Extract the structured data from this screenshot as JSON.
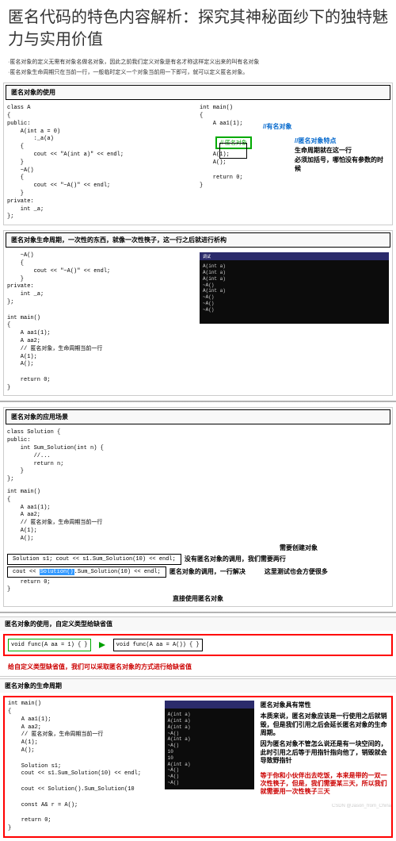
{
  "title": "匿名代码的特色内容解析：探究其神秘面纱下的独特魅力与实用价值",
  "intro1": "·匿名对象的定义无需有对象名做名对象，因此之前我们定义对象是有名才称这样定义出来的叫有名对象",
  "intro2": "·匿名对象生命周期只在当前一行，一般临时定义一个对象当前用一下即可，就可以定义匿名对象。",
  "sec1": {
    "header": "匿名对象的使用",
    "code_left": "class A\n{\npublic:\n    A(int a = 0)\n        :_a(a)\n    {\n        cout << \"A(int a)\" << endl;\n    }\n    ~A()\n    {\n        cout << \"~A()\" << endl;\n    }\nprivate:\n    int _a;\n};",
    "code_right": "int main()\n{\n    A aa1(1);\n\n\n\n    A(1);\n    A();\n\n    return 0;\n}",
    "note1": "//有名对象",
    "note_box": "// 匿名对象",
    "note2": "//匿名对象特点",
    "note3": "生命周期就在这一行",
    "note4": "必须加括号，哪怕没有参数的时候"
  },
  "sec2": {
    "header": "匿名对象生命周期，一次性的东西，就像一次性筷子，这一行之后就进行析构",
    "code": "    ~A()\n    {\n        cout << \"~A()\" << endl;\n    }\nprivate:\n    int _a;\n};\n\nint main()\n{\n    A aa1(1);\n    A aa2;\n    // 匿名对象，生命周期当前一行\n    A(1);\n    A();\n\n    return 0;\n}",
    "terminal": "A(int a)\nA(int a)\nA(int a)\n~A()\nA(int a)\n~A()\n~A()\n~A()"
  },
  "sec3": {
    "header": "匿名对象的应用场景",
    "code_top": "class Solution {\npublic:\n    int Sum_Solution(int n) {\n        //...\n        return n;\n    }\n};",
    "code_main": "int main()\n{\n    A aa1(1);\n    A aa2;\n    // 匿名对象，生命周期当前一行\n    A(1);\n    A();",
    "line_need": "需要创建对象",
    "boxed1": "Solution s1;\ncout << s1.Sum_Solution(10) << endl;",
    "annot1": "没有匿名对象的调用，我们需要两行",
    "boxed2": "cout << Solution().Sum_Solution(10) << endl;",
    "highlight": "Solution()",
    "annot2": "匿名对象的调用，一行解决",
    "annot3": "这里测试也会方便很多",
    "annot4": "直接使用匿名对象",
    "code_end": "    return 0;\n}"
  },
  "sec4": {
    "header": "匿名对象的使用，自定义类型给缺省值",
    "code_left": "void func(A aa = 1)\n{\n}",
    "code_right": "void func(A aa = A())\n{\n}",
    "red_text": "给自定义类型缺省值，我们可以采取匿名对象的方式进行给缺省值"
  },
  "sec5": {
    "header": "匿名对象的生命周期",
    "code": "int main()\n{\n    A aa1(1);\n    A aa2;\n    // 匿名对象，生命周期当前一行\n    A(1);\n    A();\n\n    Solution s1;\n    cout << s1.Sum_Solution(10) << endl;\n\n    cout << Solution().Sum_Solution(10\n\n    const A& r = A();\n\n    return 0;\n}",
    "terminal": "A(int a)\nA(int a)\nA(int a)\n~A()\nA(int a)\n~A()\n10\n10\nA(int a)\n~A()\n~A()\n~A()",
    "note1": "匿名对象具有常性",
    "note2": "本质来说，匿名对象应该是一行使用之后就销毁，但是我们引用之后会延长匿名对象的生命周期。",
    "note3": "因为匿名对象不管怎么说还是有一块空间的，此时引用之后等于用指针指向他了，销毁就会导致野指针",
    "note4": "等于你和小伙伴出去吃饭，本来是带的一双一次性筷子，但是，我们需要某三天，所以我们就需要用一次性筷子三天"
  },
  "watermark": "CSDN @Jason_from_China"
}
